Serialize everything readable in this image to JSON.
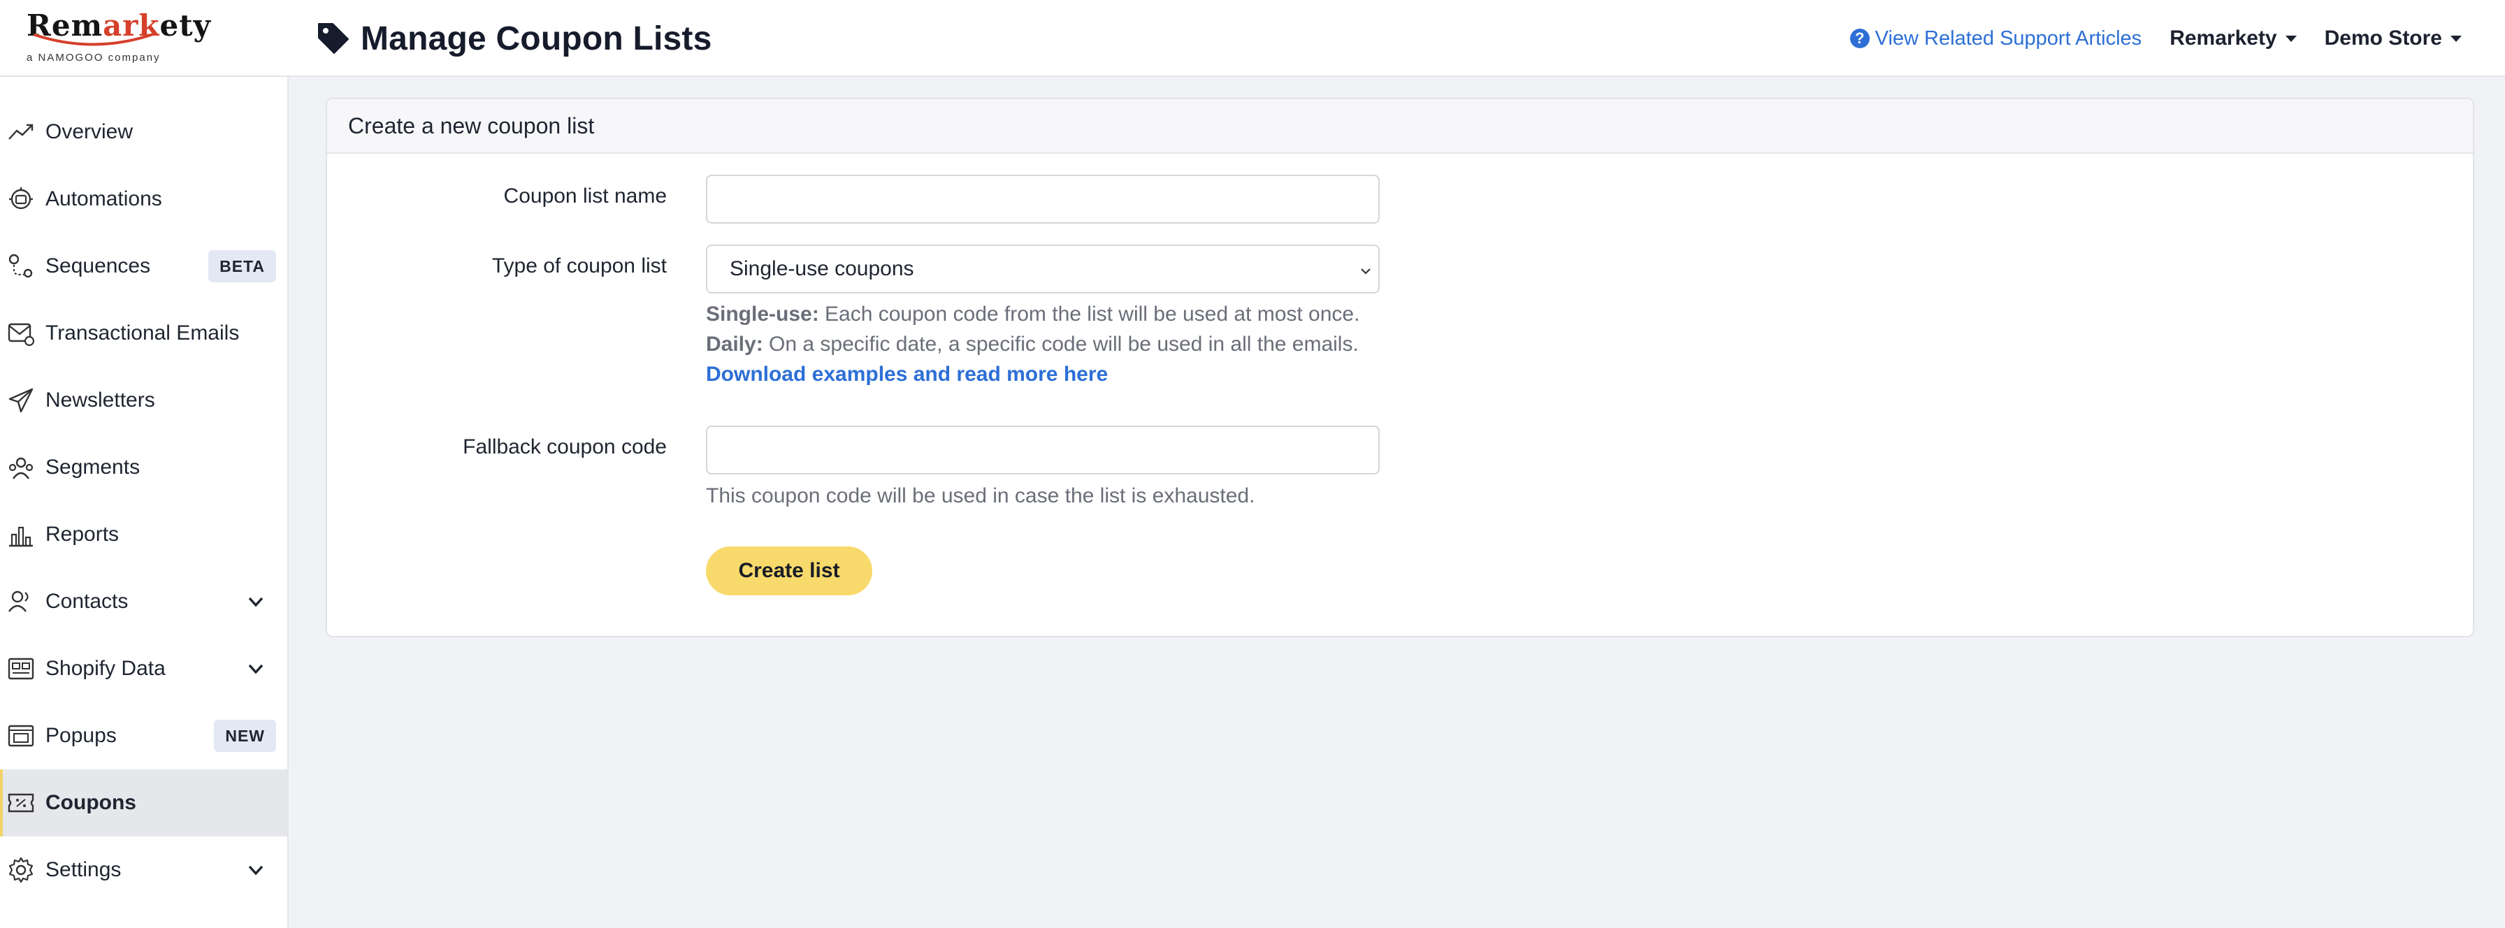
{
  "brand": {
    "logo_text_1": "Rem",
    "logo_text_2": "ark",
    "logo_text_3": "ety",
    "logo_tagline": "a NAMOGOO company"
  },
  "header": {
    "title": "Manage Coupon Lists",
    "support_link": "View Related Support Articles",
    "account_menu": "Remarkety",
    "store_menu": "Demo Store"
  },
  "sidebar": {
    "items": [
      {
        "label": "Overview",
        "icon": "trend-icon"
      },
      {
        "label": "Automations",
        "icon": "automation-icon"
      },
      {
        "label": "Sequences",
        "icon": "route-icon",
        "badge": "BETA"
      },
      {
        "label": "Transactional Emails",
        "icon": "mail-icon"
      },
      {
        "label": "Newsletters",
        "icon": "paper-plane-icon"
      },
      {
        "label": "Segments",
        "icon": "users-group-icon"
      },
      {
        "label": "Reports",
        "icon": "bar-chart-icon"
      },
      {
        "label": "Contacts",
        "icon": "contacts-icon",
        "expandable": true
      },
      {
        "label": "Shopify Data",
        "icon": "data-grid-icon",
        "expandable": true
      },
      {
        "label": "Popups",
        "icon": "popup-icon",
        "badge": "NEW"
      },
      {
        "label": "Coupons",
        "icon": "coupon-icon",
        "active": true
      },
      {
        "label": "Settings",
        "icon": "gear-icon",
        "expandable": true
      }
    ]
  },
  "form": {
    "card_title": "Create a new coupon list",
    "name_label": "Coupon list name",
    "name_value": "",
    "type_label": "Type of coupon list",
    "type_selected": "Single-use coupons",
    "single_use_term": "Single-use:",
    "single_use_desc": " Each coupon code from the list will be used at most once.",
    "daily_term": "Daily:",
    "daily_desc": " On a specific date, a specific code will be used in all the emails.",
    "examples_link": "Download examples and read more here",
    "fallback_label": "Fallback coupon code",
    "fallback_value": "",
    "fallback_help": "This coupon code will be used in case the list is exhausted.",
    "submit_label": "Create list"
  },
  "colors": {
    "accent_yellow": "#f8da6c",
    "link_blue": "#2d6fd6",
    "background": "#f1f2f6",
    "active_nav": "#e6e7eb"
  }
}
